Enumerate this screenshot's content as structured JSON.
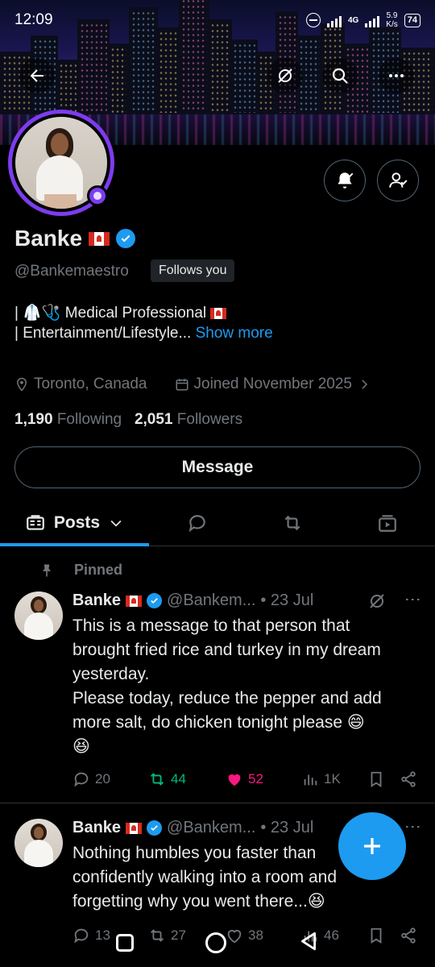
{
  "status_bar": {
    "time": "12:09",
    "network": "4G",
    "speed_value": "5.9",
    "speed_unit": "K/s",
    "battery": "74"
  },
  "profile": {
    "name": "Banke",
    "handle": "@Bankemaestro",
    "follows_you": "Follows you",
    "bio_line1": "| 🥼🩺 Medical Professional",
    "bio_line2": "| Entertainment/Lifestyle...",
    "show_more": "Show more",
    "location": "Toronto, Canada",
    "joined": "Joined November 2025",
    "following_count": "1,190",
    "following_label": "Following",
    "followers_count": "2,051",
    "followers_label": "Followers",
    "message_button": "Message"
  },
  "tabs": {
    "posts_label": "Posts"
  },
  "pinned_label": "Pinned",
  "posts": [
    {
      "name": "Banke",
      "handle": "@Bankem...",
      "date": "• 23 Jul",
      "text_line1": "This is a message to that person that",
      "text_line2": "brought fried rice and turkey in my dream",
      "text_line3": "yesterday.",
      "text_line4": "Please today, reduce the pepper and add",
      "text_line5": "more salt, do chicken tonight please 😄",
      "text_line6": "😆",
      "replies": "20",
      "reposts": "44",
      "likes": "52",
      "views": "1K"
    },
    {
      "name": "Banke",
      "handle": "@Bankem...",
      "date": "• 23 Jul",
      "text_line1": "Nothing humbles you faster than",
      "text_line2": "confidently walking into a room and",
      "text_line3": "forgetting why you went there...😆",
      "replies": "13",
      "reposts": "27",
      "likes": "38",
      "views": "46"
    }
  ],
  "colors": {
    "accent": "#1d9bf0",
    "like": "#f91880",
    "repost": "#00ba7c",
    "ring": "#7d3cf0"
  }
}
